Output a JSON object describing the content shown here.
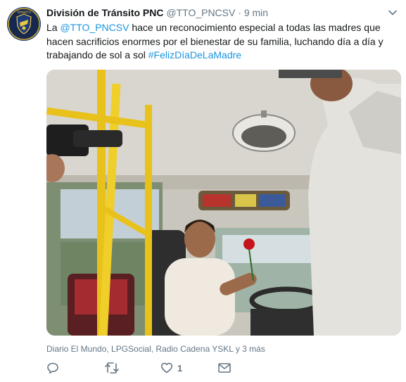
{
  "tweet": {
    "display_name": "División de Tránsito PNC",
    "handle": "@TTO_PNCSV",
    "separator": "·",
    "time": "9 min",
    "text_prefix": "La ",
    "mention": "@TTO_PNCSV",
    "text_body": " hace un reconocimiento especial a todas las madres que hacen sacrificios enormes por el bienestar de su familia, luchando día a día y trabajando de sol a sol ",
    "hashtag": "#FelizDíaDeLaMadre",
    "tagged_people": "Diario El Mundo, LPGSocial, Radio Cadena YSKL y 3 más",
    "avatar_text": "TRANSITO",
    "like_count": "1"
  },
  "icons": {
    "chevron": "chevron-down-icon",
    "reply": "reply-icon",
    "retweet": "retweet-icon",
    "like": "heart-icon",
    "dm": "envelope-icon"
  },
  "colors": {
    "link": "#1b95e0",
    "muted": "#657786",
    "avatar_bg": "#16284f"
  }
}
